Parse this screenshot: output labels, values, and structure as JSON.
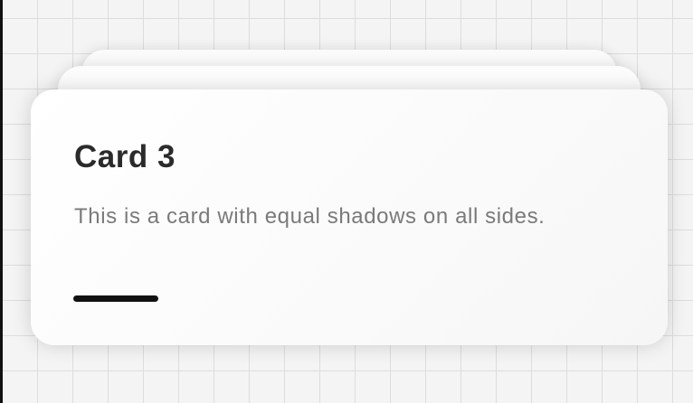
{
  "cards": [
    {
      "label": "back-card-1"
    },
    {
      "label": "back-card-2"
    },
    {
      "title": "Card 3",
      "description": "This is a card with equal shadows on all sides."
    }
  ],
  "colors": {
    "background": "#f4f4f4",
    "grid_line": "#dddddd",
    "card": "#ffffff",
    "title": "#2b2b2b",
    "description": "#7a7a7a",
    "accent": "#111111"
  }
}
